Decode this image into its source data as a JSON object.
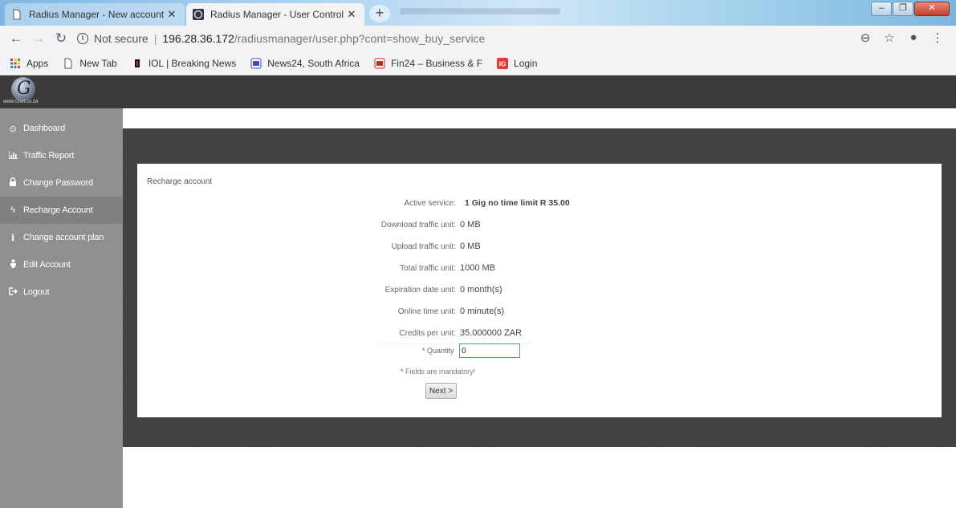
{
  "browser": {
    "tabs": [
      {
        "title": "Radius Manager - New account",
        "close": "✕",
        "active": false
      },
      {
        "title": "Radius Manager - User Control P",
        "close": "✕",
        "active": true
      }
    ],
    "new_tab_symbol": "+",
    "window_buttons": [
      "–",
      "❐",
      "✕"
    ],
    "address": {
      "security_label": "Not secure",
      "separator": "|",
      "host": "196.28.36.172",
      "path": "/radiusmanager/user.php?cont=show_buy_service"
    },
    "bookmarks": [
      {
        "label": "Apps",
        "icon": "apps-grid-icon"
      },
      {
        "label": "New Tab",
        "icon": "page-icon"
      },
      {
        "label": "IOL | Breaking News",
        "icon": "iol-icon"
      },
      {
        "label": "News24, South Africa",
        "icon": "news24-icon"
      },
      {
        "label": "Fin24 – Business & F",
        "icon": "fin24-icon"
      },
      {
        "label": "Login",
        "icon": "ig-icon"
      }
    ]
  },
  "header": {
    "logo_site_text": "www.Gnet.co.za",
    "logo_letter": "G"
  },
  "sidebar": {
    "items": [
      {
        "label": "Dashboard",
        "icon": "dashboard-gauge-icon"
      },
      {
        "label": "Traffic Report",
        "icon": "bar-chart-icon"
      },
      {
        "label": "Change Password",
        "icon": "lock-icon"
      },
      {
        "label": "Recharge Account",
        "icon": "lightning-icon"
      },
      {
        "label": "Change account plan",
        "icon": "info-icon"
      },
      {
        "label": "Edit Account",
        "icon": "user-icon"
      },
      {
        "label": "Logout",
        "icon": "sign-out-icon"
      }
    ],
    "active_index": 3
  },
  "form": {
    "title": "Recharge account",
    "rows": [
      {
        "label": "Active service:",
        "value": "1 Gig no time limit R 35.00"
      },
      {
        "label": "Download traffic unit:",
        "value": "0 MB"
      },
      {
        "label": "Upload traffic unit:",
        "value": "0 MB"
      },
      {
        "label": "Total traffic unit:",
        "value": "1000 MB"
      },
      {
        "label": "Expiration date unit:",
        "value": "0 month(s)"
      },
      {
        "label": "Online time unit:",
        "value": "0 minute(s)"
      },
      {
        "label": "Credits per unit:",
        "value": "35.000000 ZAR"
      }
    ],
    "quantity_required_mark": "*",
    "quantity_label": "Quantity",
    "quantity_value": "0",
    "mandatory_mark": "*",
    "mandatory_note": "Fields are mandatory!",
    "next_button": "Next >"
  },
  "colors": {
    "header_bg": "#3b3b3b",
    "sidebar_bg": "#8e8e8e",
    "content_band": "#414141",
    "required_mark": "#dd2222",
    "input_focus_border": "#5b8fd6"
  }
}
